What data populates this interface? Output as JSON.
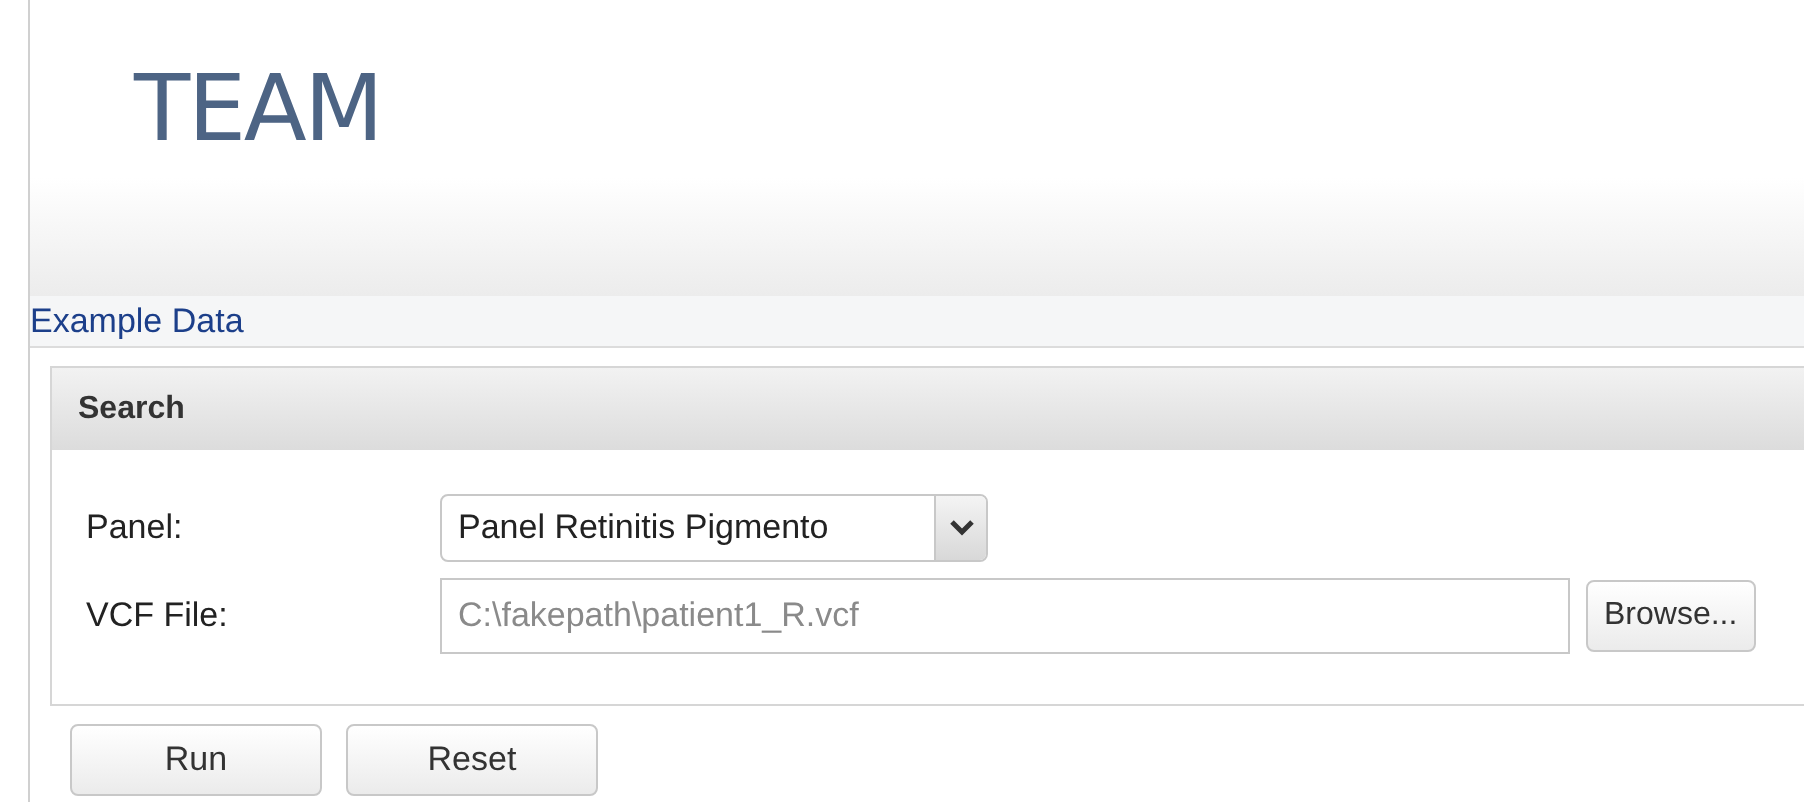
{
  "header": {
    "title": "TEAM"
  },
  "link": "Example Data",
  "search_panel": {
    "title": "Search",
    "fields": [
      {
        "kind": "select",
        "label": "Panel:",
        "value": "Panel Retinitis Pigmento"
      },
      {
        "kind": "file",
        "label": "VCF File:",
        "value": "C:\\fakepath\\patient1_R.vcf",
        "button": "Browse..."
      }
    ]
  },
  "buttons": [
    "Run",
    "Reset"
  ]
}
